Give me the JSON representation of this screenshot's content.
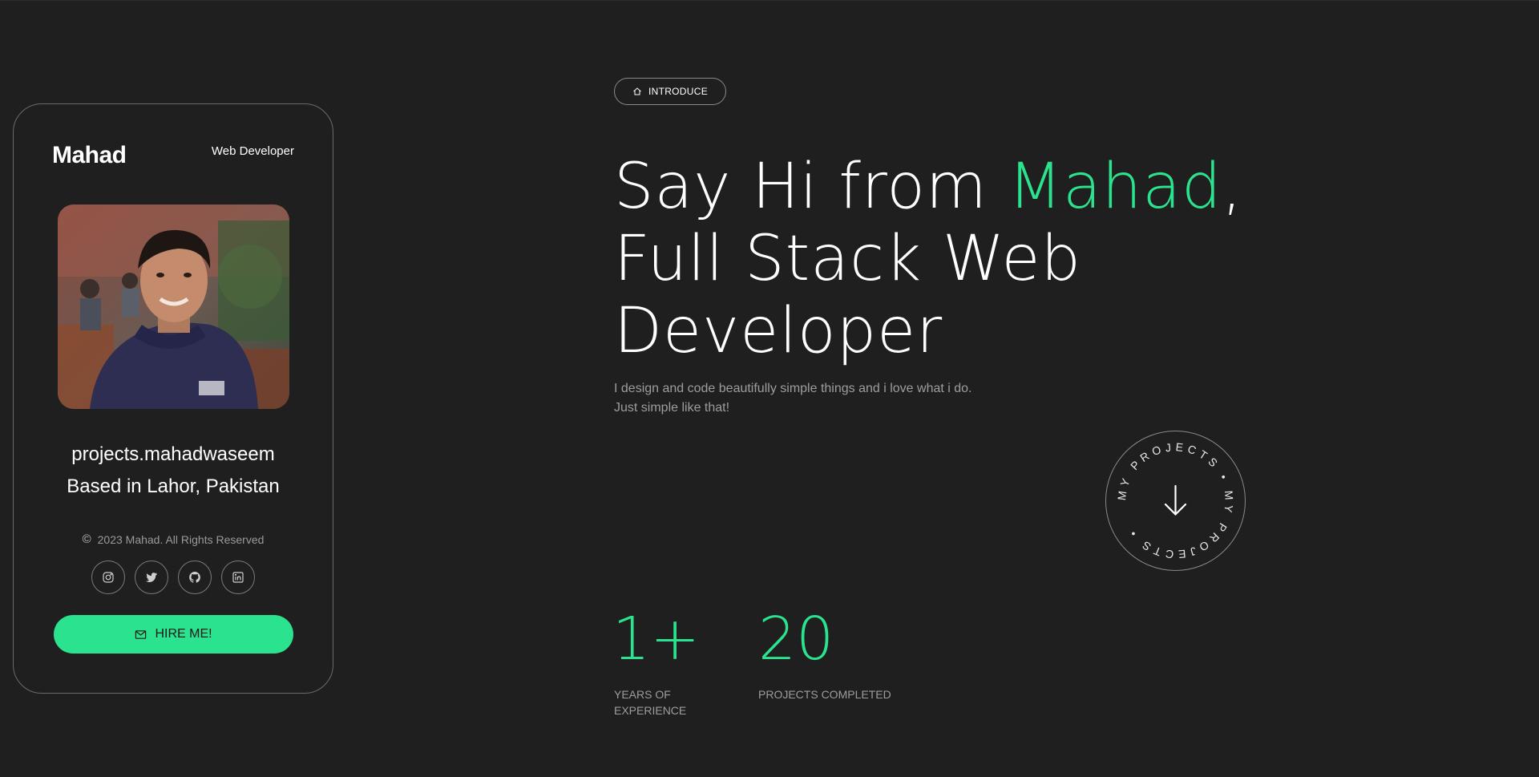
{
  "card": {
    "name": "Mahad",
    "role": "Web Developer",
    "email": "projects.mahadwaseem",
    "location": "Based in Lahor, Pakistan",
    "copyright": "2023 Mahad. All Rights Reserved",
    "socials": [
      "instagram-icon",
      "twitter-icon",
      "github-icon",
      "linkedin-icon"
    ],
    "hire_label": "HIRE ME!"
  },
  "hero": {
    "badge": "INTRODUCE",
    "headline_prefix": "Say Hi from ",
    "headline_name": "Mahad",
    "headline_comma": ",",
    "headline_line2": "Full Stack Web",
    "headline_line3": "Developer",
    "intro_line1": "I design and code beautifully simple things and i love what i do.",
    "intro_line2": "Just simple like that!",
    "circle_text": "MY PROJECTS • MY PROJECTS •"
  },
  "stats": [
    {
      "value": "1+",
      "label_line1": "YEARS OF",
      "label_line2": "EXPERIENCE"
    },
    {
      "value": "20",
      "label_line1": "PROJECTS COMPLETED",
      "label_line2": ""
    }
  ],
  "colors": {
    "background": "#1f1f1f",
    "accent": "#2be38e",
    "muted_text": "#9d9d9d",
    "border": "#6b6b6b"
  }
}
